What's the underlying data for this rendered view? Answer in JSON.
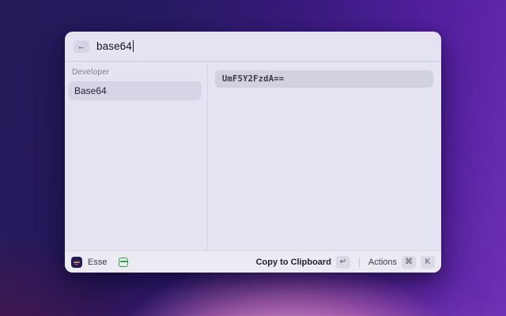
{
  "search": {
    "back_label": "←",
    "value": "base64"
  },
  "sidebar": {
    "section_label": "Developer",
    "items": [
      {
        "label": "Base64",
        "selected": true
      }
    ]
  },
  "detail": {
    "result_value": "UmF5Y2FzdA=="
  },
  "footer": {
    "app_name": "Esse",
    "primary_action_label": "Copy to Clipboard",
    "primary_action_key": "↵",
    "actions_label": "Actions",
    "actions_keys": [
      "⌘",
      "K"
    ]
  },
  "colors": {
    "window_bg": "#e5e3f1",
    "selection_bg": "#d7d4e6",
    "result_box_bg": "#d3d1df",
    "field_icon_green": "#2f9e44",
    "background_purple": "#53209f"
  }
}
